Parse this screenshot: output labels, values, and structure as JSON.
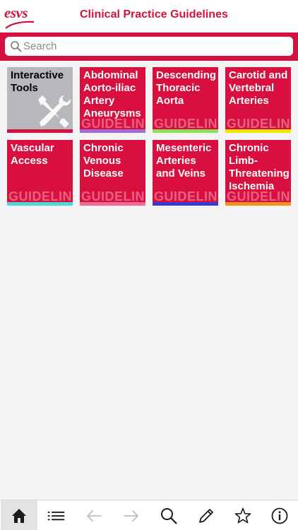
{
  "header": {
    "logo_text": "esvs",
    "title": "Clinical Practice Guidelines",
    "brand_color": "#d4123f"
  },
  "search": {
    "placeholder": "Search",
    "value": ""
  },
  "tiles": [
    {
      "label": "Interactive Tools",
      "icon": "wrench-screwdriver-icon",
      "stripe_color": "#d4123f",
      "watermark": ""
    },
    {
      "label": "Abdominal Aorto-iliac Artery Aneurysms",
      "watermark": "GUIDELINE",
      "stripe_color": "#a46cd6"
    },
    {
      "label": "Descending Thoracic Aorta",
      "watermark": "GUIDELINE",
      "stripe_color": "#8de05a"
    },
    {
      "label": "Carotid and Vertebral Arteries",
      "watermark": "GUIDELINE",
      "stripe_color": "#f5e600"
    },
    {
      "label": "Vascular Access",
      "watermark": "GUIDELINE",
      "stripe_color": "#4fd6d6"
    },
    {
      "label": "Chronic Venous Disease",
      "watermark": "GUIDELINE",
      "stripe_color": "#f06a9a"
    },
    {
      "label": "Mesenteric Arteries and Veins",
      "watermark": "GUIDELINE",
      "stripe_color": "#3a3ad6"
    },
    {
      "label": "Chronic Limb-Threatening Ischemia",
      "watermark": "GUIDELINE",
      "stripe_color": "#f5901e"
    }
  ],
  "bottom_nav": [
    {
      "icon": "home-icon",
      "active": true,
      "enabled": true
    },
    {
      "icon": "list-icon",
      "active": false,
      "enabled": true
    },
    {
      "icon": "back-arrow-icon",
      "active": false,
      "enabled": false
    },
    {
      "icon": "forward-arrow-icon",
      "active": false,
      "enabled": false
    },
    {
      "icon": "search-icon",
      "active": false,
      "enabled": true
    },
    {
      "icon": "pencil-icon",
      "active": false,
      "enabled": true
    },
    {
      "icon": "star-icon",
      "active": false,
      "enabled": true
    },
    {
      "icon": "info-icon",
      "active": false,
      "enabled": true
    }
  ]
}
